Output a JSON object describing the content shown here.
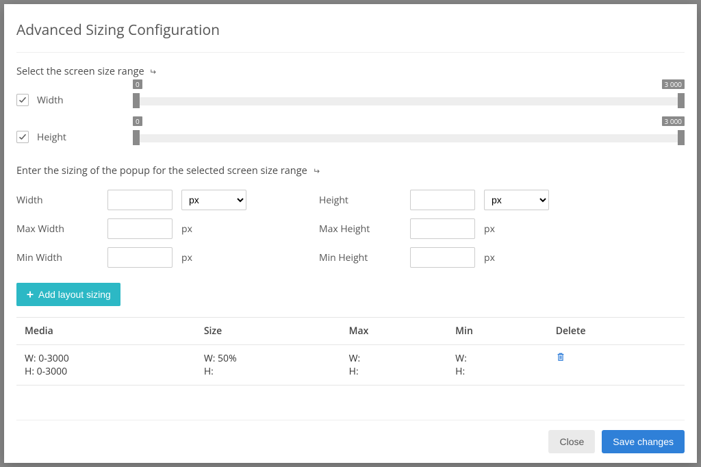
{
  "modal": {
    "title": "Advanced Sizing Configuration",
    "section_range": "Select the screen size range",
    "section_popup": "Enter the sizing of the popup for the selected screen size range"
  },
  "sliders": {
    "width_label": "Width",
    "height_label": "Height",
    "min_val": "0",
    "max_val": "3 000"
  },
  "form": {
    "width_label": "Width",
    "max_width_label": "Max Width",
    "min_width_label": "Min Width",
    "height_label": "Height",
    "max_height_label": "Max Height",
    "min_height_label": "Min Height",
    "unit_px": "px",
    "select_px": "px"
  },
  "add_button": "Add layout sizing",
  "table": {
    "headers": {
      "media": "Media",
      "size": "Size",
      "max": "Max",
      "min": "Min",
      "delete": "Delete"
    },
    "row1": {
      "media_w": "W: 0-3000",
      "media_h": "H: 0-3000",
      "size_w": "W: 50%",
      "size_h": "H:",
      "max_w": "W:",
      "max_h": "H:",
      "min_w": "W:",
      "min_h": "H:"
    }
  },
  "footer": {
    "close": "Close",
    "save": "Save changes"
  }
}
